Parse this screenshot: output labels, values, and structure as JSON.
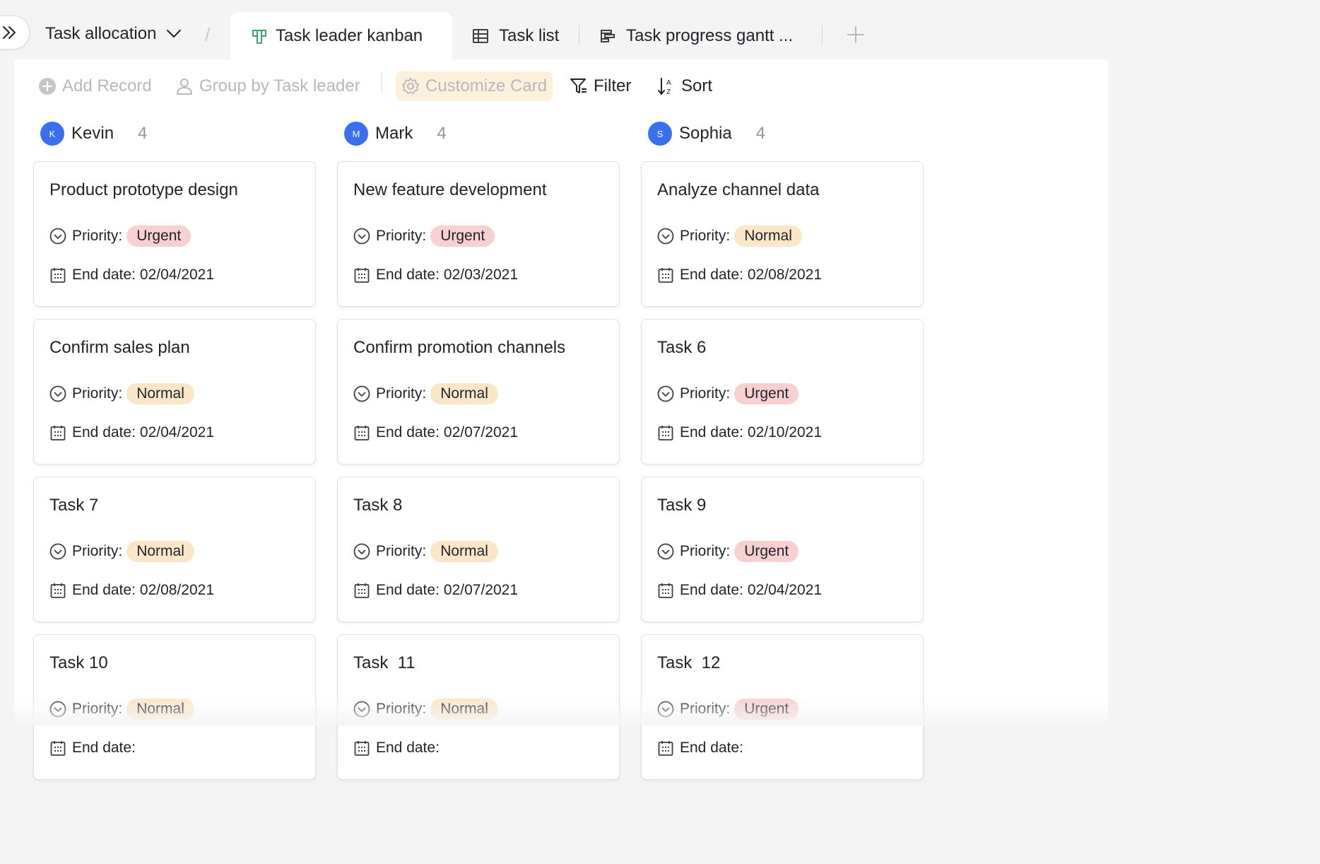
{
  "header": {
    "base_title": "Task allocation",
    "separator": "/",
    "tabs": [
      {
        "label": "Task leader kanban",
        "icon": "kanban-icon",
        "active": true
      },
      {
        "label": "Task list",
        "icon": "grid-table-icon",
        "active": false
      },
      {
        "label": "Task progress gantt ...",
        "icon": "gantt-icon",
        "active": false
      }
    ]
  },
  "toolbar": {
    "add_record": "Add Record",
    "group_by": "Group by Task leader",
    "customize_card": "Customize Card",
    "filter": "Filter",
    "sort": "Sort"
  },
  "colors": {
    "accent": "#3a6ff0",
    "urgent_tag": "#f8d0cf",
    "normal_tag": "#fbe7c8",
    "kanban_icon": "#3aa86b"
  },
  "board": {
    "priority_label": "Priority:",
    "end_date_label": "End date:",
    "columns": [
      {
        "name": "Kevin",
        "initial": "K",
        "count": "4",
        "cards": [
          {
            "title": "Product prototype design",
            "priority": "Urgent",
            "end_date": "02/04/2021"
          },
          {
            "title": "Confirm sales plan",
            "priority": "Normal",
            "end_date": "02/04/2021"
          },
          {
            "title": "Task 7",
            "priority": "Normal",
            "end_date": "02/08/2021"
          },
          {
            "title": "Task 10",
            "priority": "Normal",
            "end_date": ""
          }
        ]
      },
      {
        "name": "Mark",
        "initial": "M",
        "count": "4",
        "cards": [
          {
            "title": "New feature development",
            "priority": "Urgent",
            "end_date": "02/03/2021"
          },
          {
            "title": "Confirm promotion channels",
            "priority": "Normal",
            "end_date": "02/07/2021"
          },
          {
            "title": "Task 8",
            "priority": "Normal",
            "end_date": "02/07/2021"
          },
          {
            "title": "Task  11",
            "priority": "Normal",
            "end_date": ""
          }
        ]
      },
      {
        "name": "Sophia",
        "initial": "S",
        "count": "4",
        "cards": [
          {
            "title": "Analyze channel data",
            "priority": "Normal",
            "end_date": "02/08/2021"
          },
          {
            "title": "Task 6",
            "priority": "Urgent",
            "end_date": "02/10/2021"
          },
          {
            "title": "Task 9",
            "priority": "Urgent",
            "end_date": "02/04/2021"
          },
          {
            "title": "Task  12",
            "priority": "Urgent",
            "end_date": ""
          }
        ]
      }
    ]
  }
}
